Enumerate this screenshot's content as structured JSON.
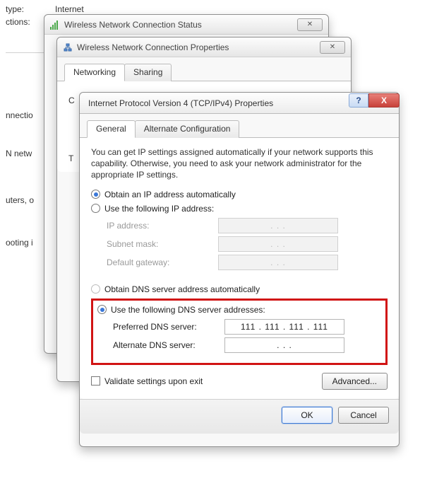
{
  "background": {
    "type_label": "type:",
    "type_value": "Internet",
    "ctions_label": "ctions:",
    "connection_label": "nnectio",
    "n_netw_label": "N netw",
    "uters_label": "uters, o",
    "ooting_label": "ooting i"
  },
  "status_win": {
    "title": "Wireless Network Connection Status"
  },
  "props_win": {
    "title": "Wireless Network Connection Properties",
    "tabs": {
      "networking": "Networking",
      "sharing": "Sharing"
    },
    "partial_c": "C",
    "partial_t": "T"
  },
  "ipv4": {
    "title": "Internet Protocol Version 4 (TCP/IPv4) Properties",
    "help": "?",
    "close": "X",
    "tabs": {
      "general": "General",
      "alt": "Alternate Configuration"
    },
    "desc": "You can get IP settings assigned automatically if your network supports this capability. Otherwise, you need to ask your network administrator for the appropriate IP settings.",
    "ip_auto": "Obtain an IP address automatically",
    "ip_manual": "Use the following IP address:",
    "ip_address_label": "IP address:",
    "subnet_label": "Subnet mask:",
    "gateway_label": "Default gateway:",
    "dns_auto": "Obtain DNS server address automatically",
    "dns_manual": "Use the following DNS server addresses:",
    "pref_dns_label": "Preferred DNS server:",
    "alt_dns_label": "Alternate DNS server:",
    "pref_dns_value": "111 . 111 . 111 . 111",
    "alt_dns_value": ".       .       .",
    "disabled_ip_value": ".       .       .",
    "validate": "Validate settings upon exit",
    "advanced": "Advanced...",
    "ok": "OK",
    "cancel": "Cancel"
  }
}
